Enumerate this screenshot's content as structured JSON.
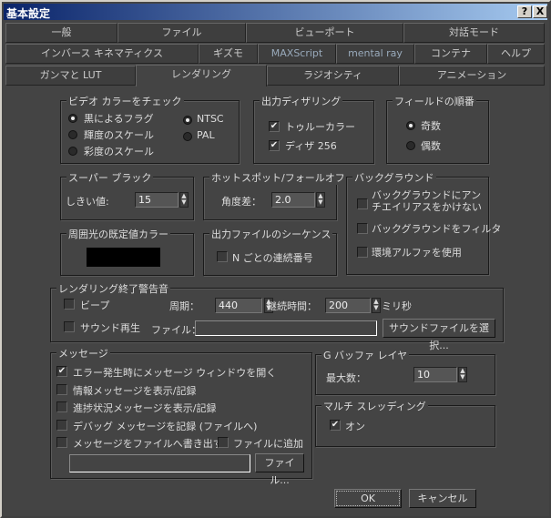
{
  "window": {
    "title": "基本設定",
    "help": "?",
    "close": "X"
  },
  "tabs": {
    "row1": [
      "一般",
      "ファイル",
      "ビューポート",
      "対話モード"
    ],
    "row2": [
      "インバース キネマティクス",
      "ギズモ",
      "MAXScript",
      "mental ray",
      "コンテナ",
      "ヘルプ"
    ],
    "row3": [
      "ガンマと LUT",
      "レンダリング",
      "ラジオシティ",
      "アニメーション"
    ],
    "active": "レンダリング"
  },
  "video": {
    "title": "ビデオ カラーをチェック",
    "opts": [
      "黒によるフラグ",
      "輝度のスケール",
      "彩度のスケール"
    ],
    "selected": "黒によるフラグ",
    "std": [
      "NTSC",
      "PAL"
    ],
    "std_selected": "NTSC"
  },
  "dither": {
    "title": "出力ディザリング",
    "truecolor": "トゥルーカラー",
    "truecolor_checked": true,
    "d256": "ディザ 256",
    "d256_checked": true
  },
  "field": {
    "title": "フィールドの順番",
    "opts": [
      "奇数",
      "偶数"
    ],
    "selected": "奇数"
  },
  "superblack": {
    "title": "スーパー ブラック",
    "label": "しきい値:",
    "value": "15"
  },
  "hotspot": {
    "title": "ホットスポット/フォールオフ",
    "label": "角度差：",
    "value": "2.0"
  },
  "background": {
    "title": "バックグラウンド",
    "opt1": "バックグラウンドにアンチエイリアスをかけない",
    "opt2": "バックグラウンドをフィルタ",
    "opt3": "環境アルファを使用",
    "checked": [
      false,
      false,
      false
    ]
  },
  "ambient": {
    "title": "周囲光の既定値カラー",
    "color": "#000000"
  },
  "sequence": {
    "title": "出力ファイルのシーケンス",
    "label": "N ごとの連続番号",
    "checked": false
  },
  "sound": {
    "title": "レンダリング終了警告音",
    "beep": "ビープ",
    "beep_checked": false,
    "period_label": "周期：",
    "period": "440",
    "duration_label": "継続時間：",
    "duration": "200",
    "ms": "ミリ秒",
    "play": "サウンド再生",
    "play_checked": false,
    "file_label": "ファイル：",
    "file": "",
    "choose": "サウンドファイルを選択..."
  },
  "messages": {
    "title": "メッセージ",
    "items": [
      "エラー発生時にメッセージ ウィンドウを開く",
      "情報メッセージを表示/記録",
      "進捗状況メッセージを表示/記録",
      "デバッグ メッセージを記録 (ファイルへ)",
      "メッセージをファイルへ書き出す"
    ],
    "checked": [
      true,
      false,
      false,
      false,
      false
    ],
    "append": "ファイルに追加",
    "append_checked": false,
    "file": "",
    "file_btn": "ファイル..."
  },
  "gbuffer": {
    "title": "G バッファ レイヤ",
    "label": "最大数：",
    "value": "10"
  },
  "multi": {
    "title": "マルチ スレッディング",
    "label": "オン",
    "checked": true
  },
  "buttons": {
    "ok": "OK",
    "cancel": "キャンセル"
  }
}
